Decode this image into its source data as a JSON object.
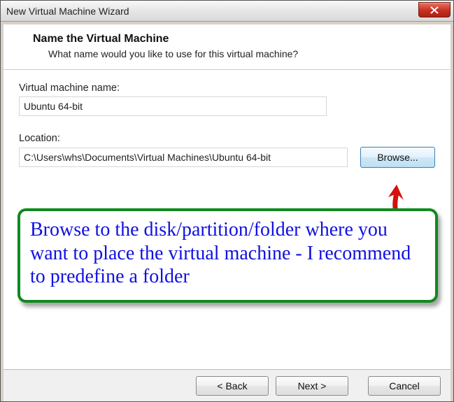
{
  "window": {
    "title": "New Virtual Machine Wizard",
    "close_label": "Close"
  },
  "header": {
    "step_title": "Name the Virtual Machine",
    "step_desc": "What name would you like to use for this virtual machine?"
  },
  "form": {
    "vm_name_label": "Virtual machine name:",
    "vm_name_value": "Ubuntu 64-bit",
    "location_label": "Location:",
    "location_value": "C:\\Users\\whs\\Documents\\Virtual Machines\\Ubuntu 64-bit",
    "browse_label": "Browse..."
  },
  "callout": {
    "text": "Browse to the disk/partition/folder where you want to place the virtual machine - I recommend to predefine a folder"
  },
  "buttons": {
    "back": "< Back",
    "next": "Next >",
    "cancel": "Cancel"
  }
}
